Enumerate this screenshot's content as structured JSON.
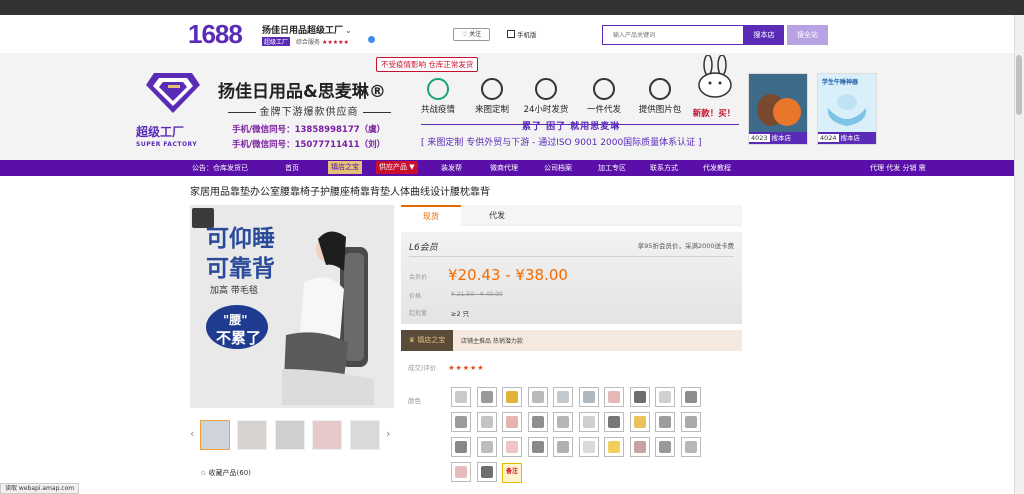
{
  "header": {
    "logo": "1688",
    "shop_name": "扬佳日用品超级工厂",
    "shop_badge": "超级工厂",
    "rating_label": "综合服务",
    "rating_stars": "★★★★★",
    "follow_label": "关注",
    "mobile_label": "手机版",
    "search_placeholder": "输入产品关键词",
    "search_store_label": "搜本店",
    "search_all_label": "搜全站"
  },
  "banner": {
    "notice": "不受疫情影响 仓库正常发货",
    "logo_cn": "超级工厂",
    "logo_en": "SUPER FACTORY",
    "brand_title": "扬佳日用品&思麦琳®",
    "brand_sub": "金牌下游爆款供应商",
    "phone1": "手机/微信同号：13858998177（虞）",
    "phone2": "手机/微信同号：15077711411（刘）",
    "features": [
      "共战疫情",
      "来图定制",
      "24小时发货",
      "一件代发",
      "提供图片包",
      "新款！买！"
    ],
    "slogan": "累了 困了 就用思麦琳",
    "cert": "[ 来图定制 专供外贸与下游 - 通过ISO 9001 2000国际质量体系认证 ]",
    "products": [
      {
        "num": "4023",
        "label": "搜本店"
      },
      {
        "num": "4024",
        "label": "搜本店"
      }
    ],
    "product2_caption": "学生午睡神器"
  },
  "nav": {
    "announcement": "公告：仓库发货已",
    "items": [
      "首页",
      "镇店之宝",
      "供应产品 ▼",
      "装发帮",
      "微商代理",
      "公司档案",
      "加工专区",
      "联系方式",
      "代发教程"
    ],
    "right": "代理 代发 分销 需"
  },
  "product": {
    "title": "家居用品靠垫办公室腰靠椅子护腰座椅靠背垫人体曲线设计腰枕靠背",
    "image_text": {
      "line1": "可仰睡",
      "line2": "可靠背",
      "line3": "加高 带毛毯",
      "line4": "\"腰\"",
      "line5": "不累了"
    },
    "collect": "收藏产品(60)",
    "tabs": [
      "现货",
      "代发"
    ],
    "level": "L6会员",
    "level_note": "享95折会员价，采满2000送卡费",
    "member_price_label": "会员价",
    "member_price": "¥20.43 - ¥38.00",
    "price_label": "价格",
    "old_price": "¥ 21.50 - ¥ 40.00",
    "moq_label": "起批量",
    "moq": "≥2 只",
    "strip_badge": "镇店之宝",
    "strip_text": "店铺主推品  热销潜力款",
    "review_label": "成交|评价",
    "review_stars": "★★★★★",
    "color_label": "颜色",
    "note_swatch": "备注"
  },
  "status": "读取 webapi.amap.com",
  "colors": {
    "brand_purple": "#5a2bb7",
    "nav_purple": "#5a0fa8",
    "price_orange": "#f56b00"
  }
}
